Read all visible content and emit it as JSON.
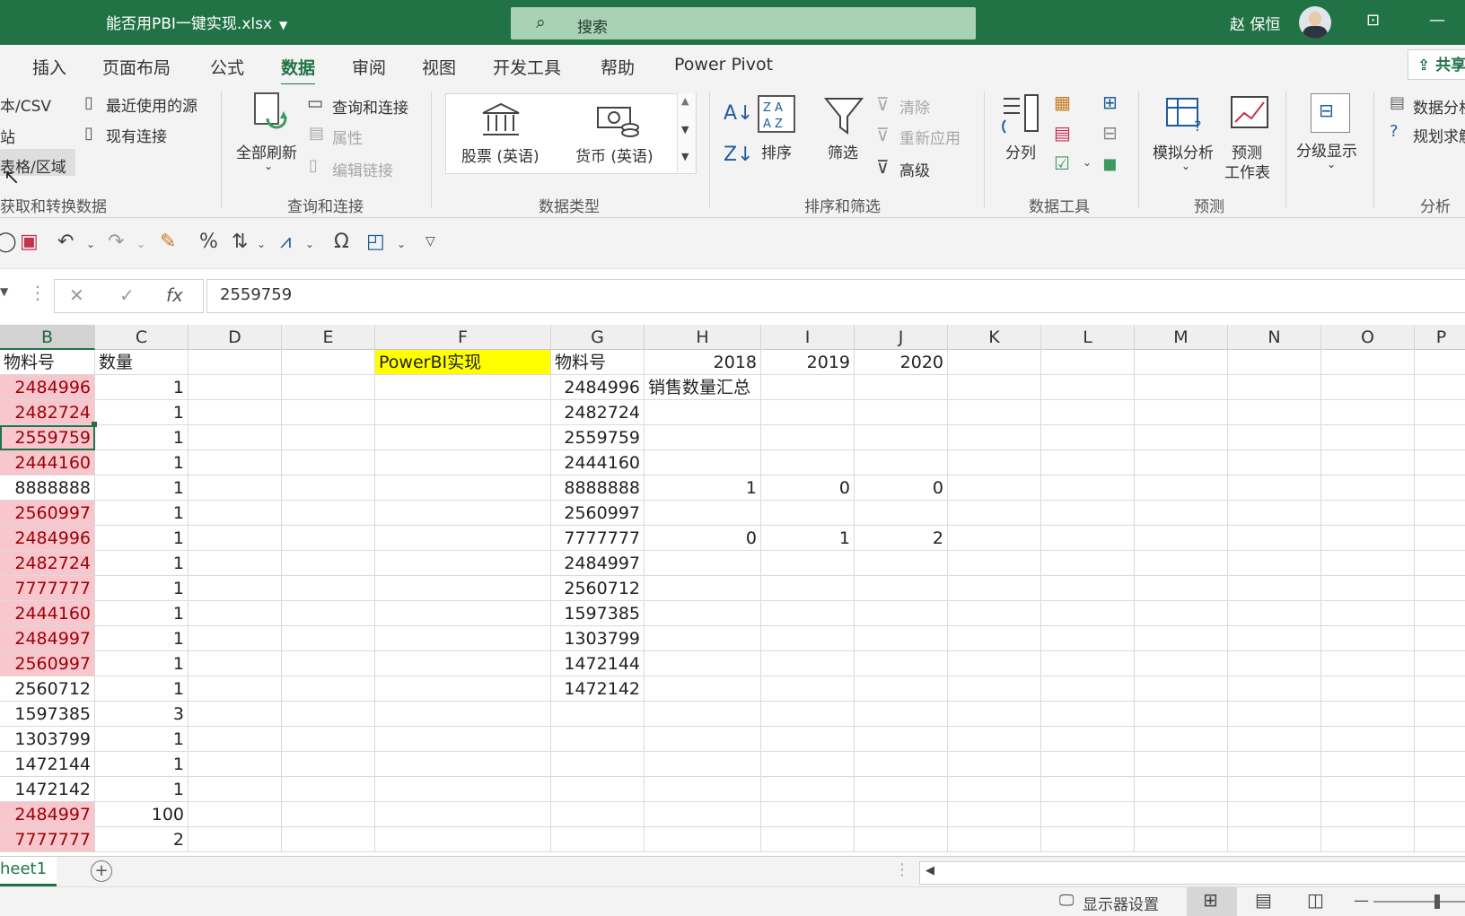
{
  "title_bar": {
    "file_name": "能否用PBI一键实现.xlsx",
    "search_placeholder": "搜索",
    "user_name": "赵 保恒"
  },
  "ribbon_tabs": [
    "插入",
    "页面布局",
    "公式",
    "数据",
    "审阅",
    "视图",
    "开发工具",
    "帮助",
    "Power Pivot"
  ],
  "active_tab": "数据",
  "share_label": "共享",
  "ribbon": {
    "get_transform": {
      "text_csv": "本/CSV",
      "web": "站",
      "table_range": "表格/区域",
      "recent_sources": "最近使用的源",
      "existing_connections": "现有连接",
      "group_label": "获取和转换数据"
    },
    "queries": {
      "refresh_all": "全部刷新",
      "queries_connections": "查询和连接",
      "properties": "属性",
      "edit_links": "编辑链接",
      "group_label": "查询和连接"
    },
    "data_types": {
      "stocks": "股票 (英语)",
      "currencies": "货币 (英语)",
      "group_label": "数据类型"
    },
    "sort_filter": {
      "sort": "排序",
      "filter": "筛选",
      "clear": "清除",
      "reapply": "重新应用",
      "advanced": "高级",
      "group_label": "排序和筛选"
    },
    "data_tools": {
      "text_to_columns": "分列",
      "group_label": "数据工具"
    },
    "forecast": {
      "what_if": "模拟分析",
      "forecast_sheet": "预测\n工作表",
      "group_label": "预测"
    },
    "outline": {
      "outline": "分级显示"
    },
    "analyze": {
      "data_analysis": "数据分析",
      "solver": "规划求解",
      "group_label": "分析"
    }
  },
  "formula_bar": {
    "cancel": "✕",
    "enter": "✓",
    "fx": "fx",
    "value": "2559759"
  },
  "columns": [
    "B",
    "C",
    "D",
    "E",
    "F",
    "G",
    "H",
    "I",
    "J",
    "K",
    "L",
    "M",
    "N",
    "O",
    "P"
  ],
  "selected_column": "B",
  "table_left": {
    "header_b": "物料号",
    "header_c": "数量",
    "rows": [
      {
        "b": "2484996",
        "c": "1",
        "pink": true
      },
      {
        "b": "2482724",
        "c": "1",
        "pink": true
      },
      {
        "b": "2559759",
        "c": "1",
        "pink": true,
        "selected": true
      },
      {
        "b": "2444160",
        "c": "1",
        "pink": true
      },
      {
        "b": "8888888",
        "c": "1",
        "pink": false
      },
      {
        "b": "2560997",
        "c": "1",
        "pink": true
      },
      {
        "b": "2484996",
        "c": "1",
        "pink": true
      },
      {
        "b": "2482724",
        "c": "1",
        "pink": true
      },
      {
        "b": "7777777",
        "c": "1",
        "pink": true
      },
      {
        "b": "2444160",
        "c": "1",
        "pink": true
      },
      {
        "b": "2484997",
        "c": "1",
        "pink": true
      },
      {
        "b": "2560997",
        "c": "1",
        "pink": true
      },
      {
        "b": "2560712",
        "c": "1",
        "pink": false
      },
      {
        "b": "1597385",
        "c": "3",
        "pink": false
      },
      {
        "b": "1303799",
        "c": "1",
        "pink": false
      },
      {
        "b": "1472144",
        "c": "1",
        "pink": false
      },
      {
        "b": "1472142",
        "c": "1",
        "pink": false
      },
      {
        "b": "2484997",
        "c": "100",
        "pink": true
      },
      {
        "b": "7777777",
        "c": "2",
        "pink": true
      }
    ]
  },
  "f1_label": "PowerBI实现",
  "table_right": {
    "header_g": "物料号",
    "years": [
      "2018",
      "2019",
      "2020"
    ],
    "summary_label": "销售数量汇总",
    "items": [
      "2484996",
      "2482724",
      "2559759",
      "2444160",
      "8888888",
      "2560997",
      "7777777",
      "2484997",
      "2560712",
      "1597385",
      "1303799",
      "1472144",
      "1472142"
    ],
    "values": {
      "row5": [
        "1",
        "0",
        "0"
      ],
      "row7": [
        "0",
        "1",
        "2"
      ]
    }
  },
  "sheet_tab": "heet1",
  "add_sheet": "+",
  "status_bar": {
    "display_settings": "显示器设置"
  },
  "colors": {
    "excel_green": "#217346",
    "pink_fill": "#f8c7ce",
    "pink_text": "#9c0006",
    "yellow_fill": "#ffff00"
  }
}
